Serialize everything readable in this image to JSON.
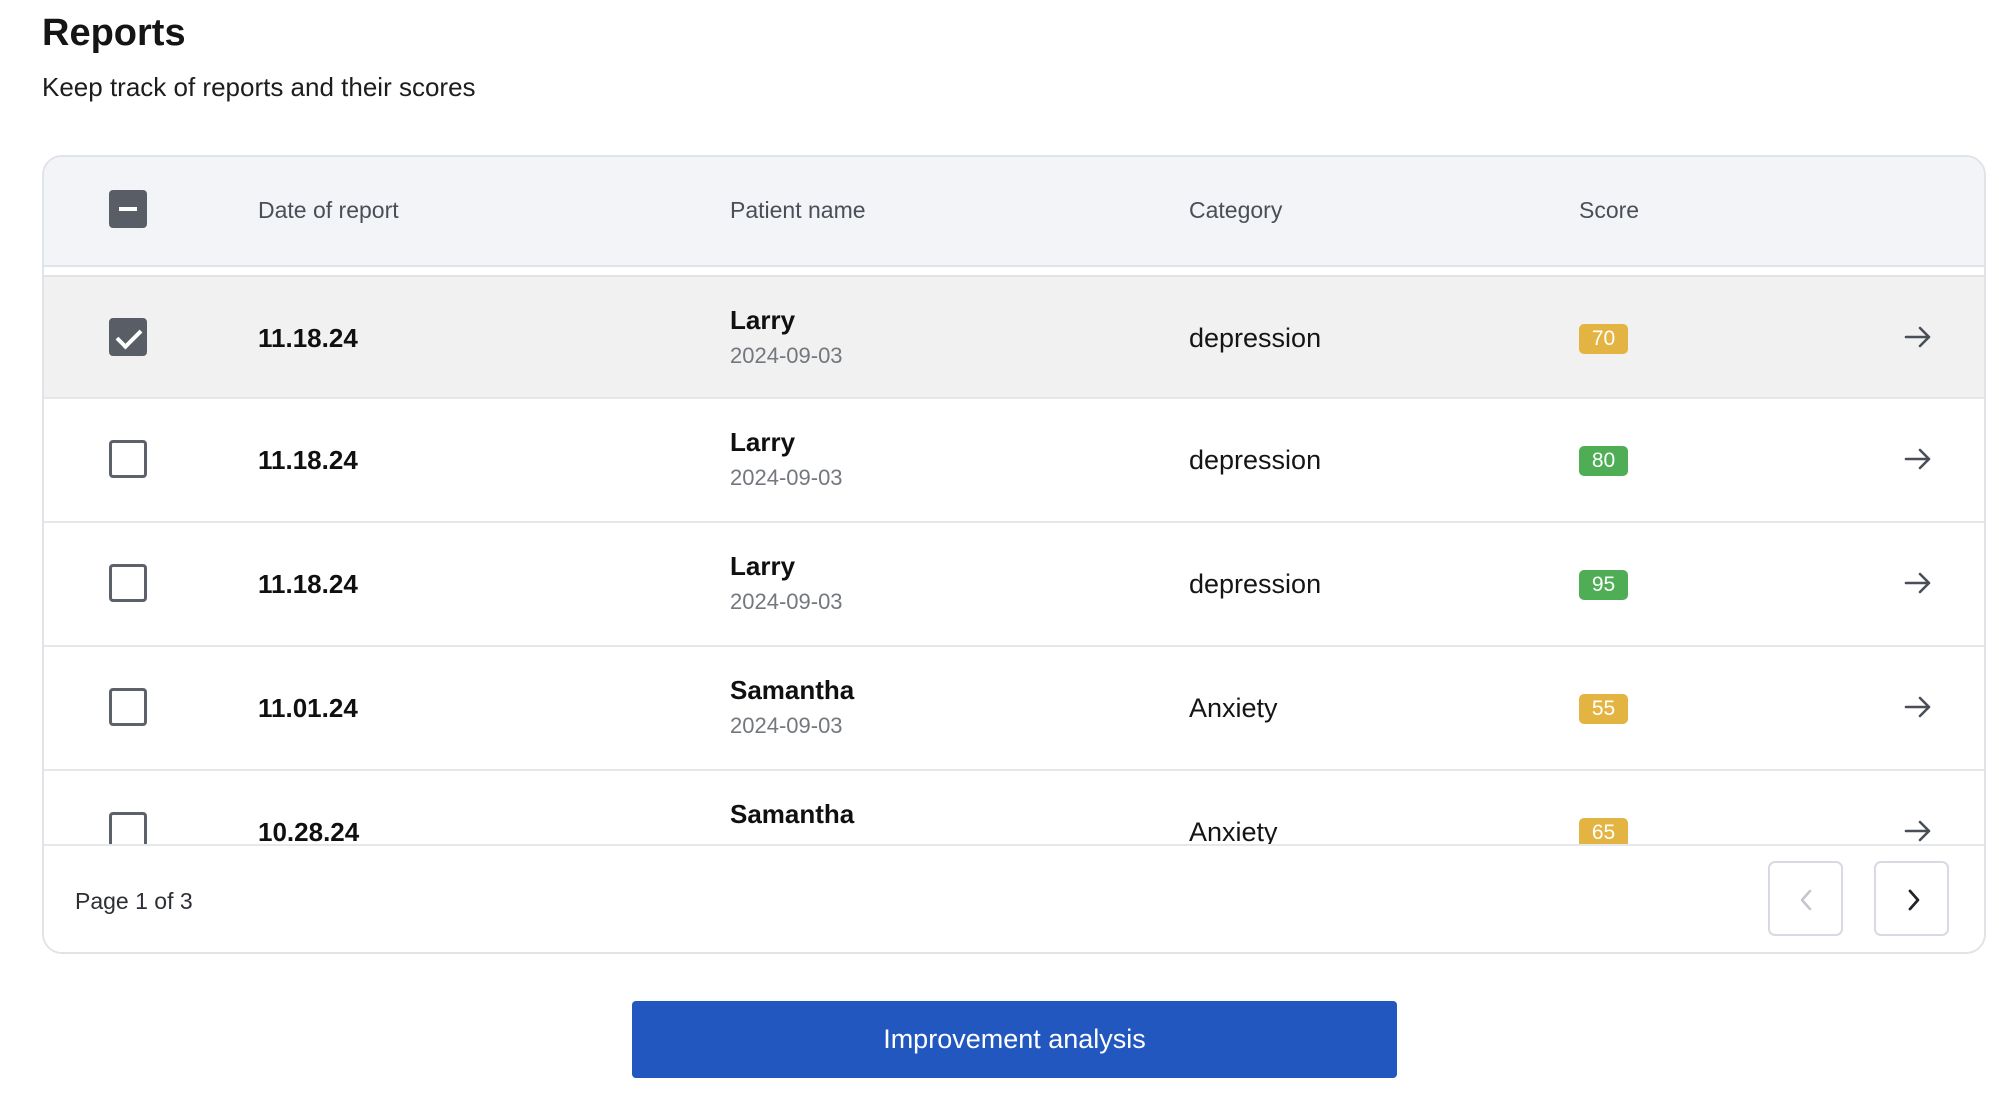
{
  "header": {
    "title": "Reports",
    "subtitle": "Keep track of reports and their scores"
  },
  "table": {
    "columns": {
      "date": "Date of report",
      "patient": "Patient name",
      "category": "Category",
      "score": "Score"
    },
    "rows": [
      {
        "date": "11.18.24",
        "patient_name": "Larry",
        "patient_date": "2024-09-03",
        "category": "depression",
        "score": "70",
        "score_color": "#e4b443",
        "selected": true
      },
      {
        "date": "11.18.24",
        "patient_name": "Larry",
        "patient_date": "2024-09-03",
        "category": "depression",
        "score": "80",
        "score_color": "#4fae55",
        "selected": false
      },
      {
        "date": "11.18.24",
        "patient_name": "Larry",
        "patient_date": "2024-09-03",
        "category": "depression",
        "score": "95",
        "score_color": "#4fae55",
        "selected": false
      },
      {
        "date": "11.01.24",
        "patient_name": "Samantha",
        "patient_date": "2024-09-03",
        "category": "Anxiety",
        "score": "55",
        "score_color": "#e4b443",
        "selected": false
      },
      {
        "date": "10.28.24",
        "patient_name": "Samantha",
        "patient_date": "",
        "category": "Anxiety",
        "score": "65",
        "score_color": "#e4b443",
        "selected": false
      }
    ]
  },
  "pagination": {
    "label": "Page 1 of 3"
  },
  "actions": {
    "improvement_label": "Improvement analysis"
  },
  "colors": {
    "primary": "#2257bf",
    "score_green": "#4fae55",
    "score_yellow": "#e4b443"
  },
  "icons": {
    "row_action": "arrow-right-icon",
    "prev": "chevron-left-icon",
    "next": "chevron-right-icon"
  }
}
